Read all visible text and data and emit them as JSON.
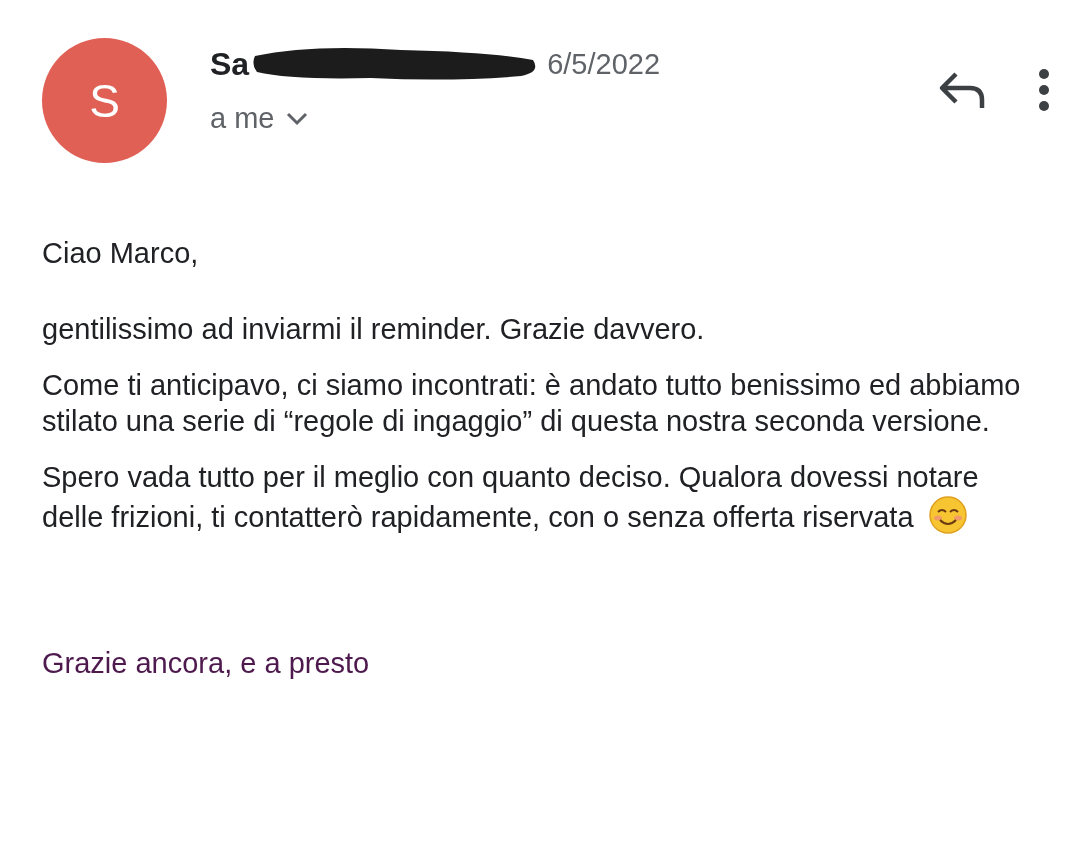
{
  "header": {
    "avatar_letter": "S",
    "sender": "Sa",
    "date": "6/5/2022",
    "recipient": "a me"
  },
  "body": {
    "greeting": "Ciao Marco,",
    "paragraphs": [
      "gentilissimo ad inviarmi il reminder. Grazie davvero.",
      "Come ti anticipavo, ci siamo incontrati: è andato tutto benissimo ed abbiamo stilato una serie di “regole di ingaggio” di questa nostra seconda versione.",
      "Spero vada tutto per il meglio con quanto deciso. Qualora dovessi notare delle frizioni, ti contatterò rapidamente, con o senza offerta riservata"
    ],
    "signature": "Grazie ancora, e a presto"
  }
}
